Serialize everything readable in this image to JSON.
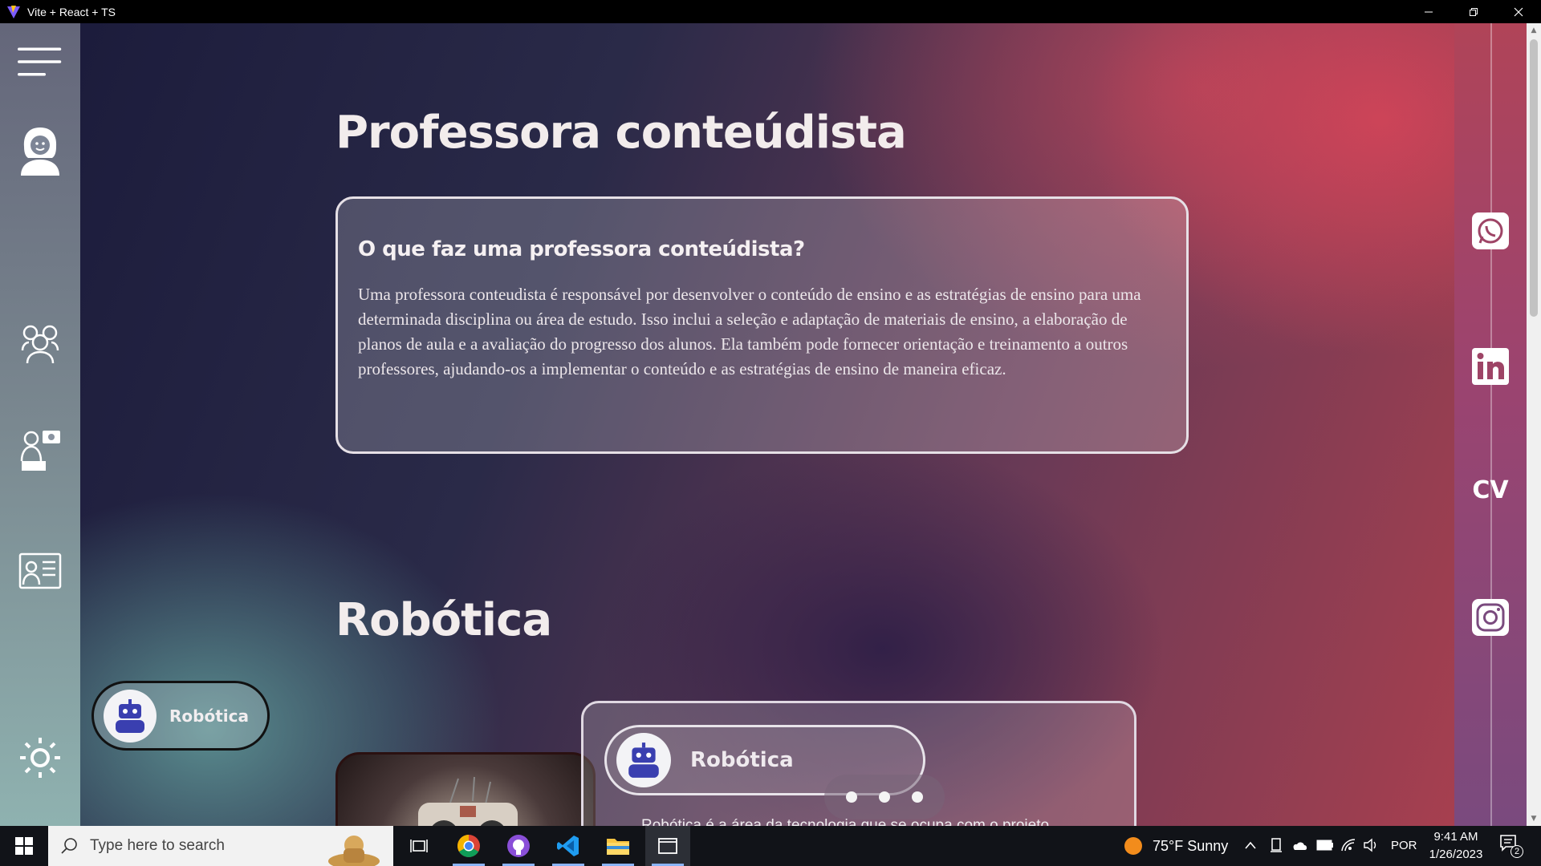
{
  "window": {
    "title": "Vite + React + TS"
  },
  "sidebar": {
    "items": [
      {
        "name": "menu",
        "icon": "hamburger-menu-icon"
      },
      {
        "name": "profile",
        "icon": "woman-avatar-icon"
      },
      {
        "name": "team",
        "icon": "group-people-icon"
      },
      {
        "name": "teacher",
        "icon": "teacher-presenting-icon"
      },
      {
        "name": "resume",
        "icon": "profile-document-icon"
      },
      {
        "name": "theme",
        "icon": "sun-icon"
      }
    ]
  },
  "section1": {
    "title": "Professora conteúdista",
    "card_heading": "O que faz uma professora conteúdista?",
    "card_text": "Uma professora conteudista é responsável por desenvolver o conteúdo de ensino e as estratégias de ensino para uma determinada disciplina ou área de estudo. Isso inclui a seleção e adaptação de materiais de ensino, a elaboração de planos de aula e a avaliação do progresso dos alunos. Ela também pode fornecer orientação e treinamento a outros professores, ajudando-os a implementar o conteúdo e as estratégias de ensino de maneira eficaz."
  },
  "section2": {
    "title": "Robótica",
    "chip_label": "Robótica",
    "pill_label": "Robótica",
    "description": "Robótica é a área da tecnologia que se ocupa com o projeto"
  },
  "social": {
    "items": [
      {
        "name": "whatsapp",
        "icon": "whatsapp-icon"
      },
      {
        "name": "linkedin",
        "icon": "linkedin-icon"
      },
      {
        "name": "cv",
        "label": "CV"
      },
      {
        "name": "instagram",
        "icon": "instagram-icon"
      }
    ]
  },
  "taskbar": {
    "search_placeholder": "Type here to search",
    "weather": "75°F  Sunny",
    "language": "POR",
    "time": "9:41 AM",
    "date": "1/26/2023",
    "notifications": "2"
  },
  "colors": {
    "accent_red": "#b0404e",
    "robot_blue": "#3a3fb0",
    "sidebar_teal": "#8fb2b0"
  }
}
